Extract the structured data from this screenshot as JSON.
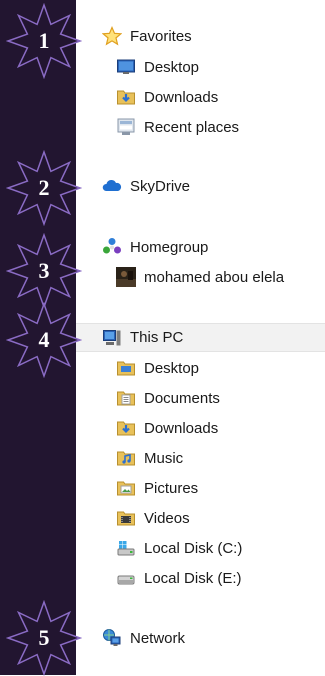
{
  "colors": {
    "sidebar_band": "#221530",
    "badge_fill": "#221530",
    "badge_stroke": "#8a6bc4",
    "selected_row": "#f2f2f2"
  },
  "favorites": {
    "label": "Favorites",
    "icon": "star-icon",
    "items": [
      {
        "label": "Desktop",
        "icon": "desktop-icon"
      },
      {
        "label": "Downloads",
        "icon": "downloads-folder-icon"
      },
      {
        "label": "Recent places",
        "icon": "recent-places-icon"
      }
    ]
  },
  "skydrive": {
    "label": "SkyDrive",
    "icon": "cloud-icon"
  },
  "homegroup": {
    "label": "Homegroup",
    "icon": "homegroup-icon",
    "items": [
      {
        "label": "mohamed abou elela",
        "icon": "user-avatar"
      }
    ]
  },
  "this_pc": {
    "label": "This PC",
    "icon": "computer-icon",
    "items": [
      {
        "label": "Desktop",
        "icon": "desktop-folder-icon"
      },
      {
        "label": "Documents",
        "icon": "documents-folder-icon"
      },
      {
        "label": "Downloads",
        "icon": "downloads-folder-icon"
      },
      {
        "label": "Music",
        "icon": "music-folder-icon"
      },
      {
        "label": "Pictures",
        "icon": "pictures-folder-icon"
      },
      {
        "label": "Videos",
        "icon": "videos-folder-icon"
      },
      {
        "label": "Local Disk (C:)",
        "icon": "system-drive-icon"
      },
      {
        "label": "Local Disk (E:)",
        "icon": "drive-icon"
      }
    ]
  },
  "network": {
    "label": "Network",
    "icon": "network-icon"
  },
  "badges": [
    "1",
    "2",
    "3",
    "4",
    "5"
  ]
}
